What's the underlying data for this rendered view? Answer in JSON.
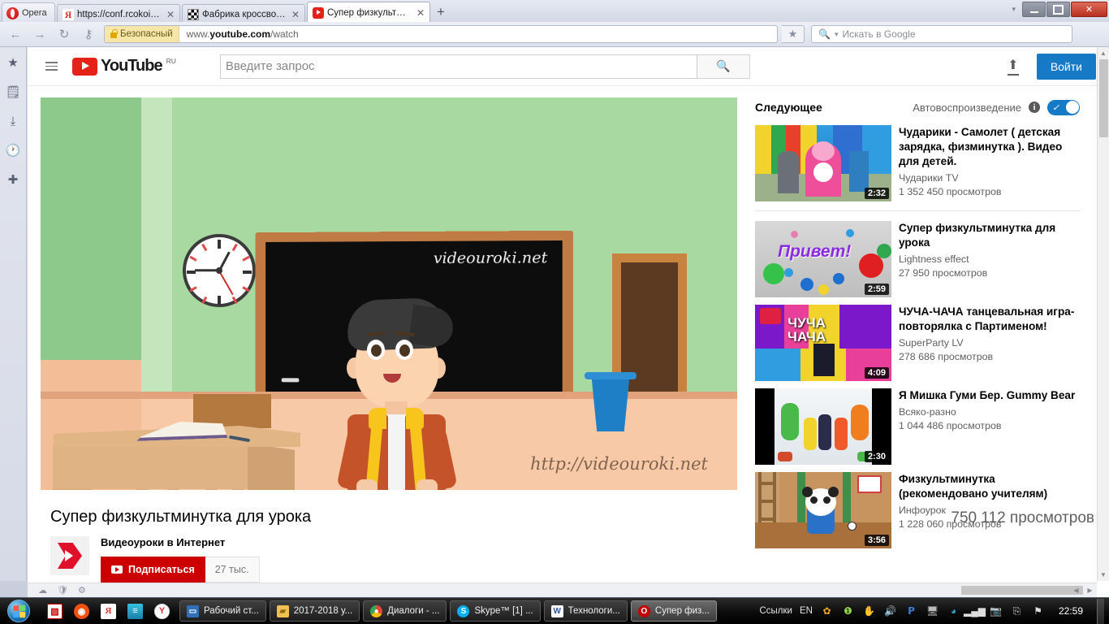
{
  "browser": {
    "name": "Opera",
    "tabs": [
      {
        "title": "https://conf.rcokoit.ru ...",
        "favicon": "yandex-icon",
        "active": false
      },
      {
        "title": "Фабрика кроссвордов",
        "favicon": "crossword-icon",
        "active": false
      },
      {
        "title": "Супер физкультминут...",
        "favicon": "youtube-icon",
        "active": true
      }
    ],
    "new_tab_label": "+",
    "close_label": "✕",
    "window_controls": {
      "minimize": "—",
      "maximize": "❐",
      "close": "✕",
      "caret": "▾"
    },
    "nav": {
      "back": "←",
      "forward": "→",
      "reload": "↻",
      "key": "⚷",
      "security_label": "Безопасный",
      "url_prefix": "www.",
      "url_domain": "youtube.com",
      "url_path": "/watch",
      "bookmark": "★",
      "search_placeholder": "Искать в Google",
      "search_icon": "search-icon",
      "search_caret": "▾"
    },
    "sidebar_icons": [
      "star-icon",
      "notes-icon",
      "downloads-icon",
      "history-icon",
      "add-icon"
    ]
  },
  "youtube": {
    "header": {
      "menu_icon": "hamburger-icon",
      "logo_word": "YouTube",
      "locale": "RU",
      "search_placeholder": "Введите запрос",
      "search_icon": "search-icon",
      "upload_icon": "upload-icon",
      "signin_label": "Войти"
    },
    "video": {
      "title": "Супер физкультминутка для урока",
      "channel": "Видеоуроки в Интернет",
      "subscribe_label": "Подписаться",
      "subscriber_count": "27 тыс.",
      "view_count": "750 112 просмотров",
      "board_watermark": "videouroki.net",
      "url_watermark": "http://videouroki.net"
    },
    "sidebar": {
      "header": "Следующее",
      "autoplay_label": "Автовоспроизведение",
      "info_icon": "info-icon",
      "autoplay_on": true,
      "related": [
        {
          "title": "Чударики - Самолет ( детская зарядка, физминутка ). Видео для детей.",
          "channel": "Чударики TV",
          "views": "1 352 450 просмотров",
          "duration": "2:32"
        },
        {
          "title": "Супер физкультминутка для урока",
          "channel": "Lightness effect",
          "views": "27 950 просмотров",
          "duration": "2:59"
        },
        {
          "title": "ЧУЧА-ЧАЧА танцевальная игра-повторялка с Партименом!",
          "channel": "SuperParty LV",
          "views": "278 686 просмотров",
          "duration": "4:09"
        },
        {
          "title": "Я Мишка Гуми Бер. Gummy Bear",
          "channel": "Всяко-разно",
          "views": "1 044 486 просмотров",
          "duration": "2:30"
        },
        {
          "title": "Физкультминутка (рекомендовано учителям)",
          "channel": "Инфоурок",
          "views": "1 228 060 просмотров",
          "duration": "3:56"
        }
      ]
    },
    "thumbnail_labels": {
      "hello": "Привет!",
      "chucha_line1": "ЧУЧА",
      "chucha_line2": "ЧАЧА"
    }
  },
  "taskbar": {
    "start_icon": "windows-start-icon",
    "quick_launch": [
      "media-icon",
      "player-icon",
      "yandex-icon",
      "archive-icon",
      "yandex-browser-icon"
    ],
    "tasks": [
      {
        "label": "Рабочий ст...",
        "icon": "desktop-icon",
        "active": false
      },
      {
        "label": "2017-2018 у...",
        "icon": "folder-icon",
        "active": false
      },
      {
        "label": "Диалоги - ...",
        "icon": "chrome-icon",
        "active": false
      },
      {
        "label": "Skype™ [1] ...",
        "icon": "skype-icon",
        "active": false
      },
      {
        "label": "Технологи...",
        "icon": "word-icon",
        "active": false
      },
      {
        "label": "Супер физ...",
        "icon": "opera-icon",
        "active": true
      }
    ],
    "tray": {
      "links_label": "Ссылки",
      "language": "EN",
      "icons": [
        "flower-icon",
        "update-icon",
        "hand-icon",
        "volume-icon",
        "punto-icon",
        "network-monitor-icon",
        "antivirus-icon",
        "signal-icon",
        "camera-icon",
        "usb-icon",
        "flag-icon"
      ],
      "clock": "22:59"
    }
  }
}
